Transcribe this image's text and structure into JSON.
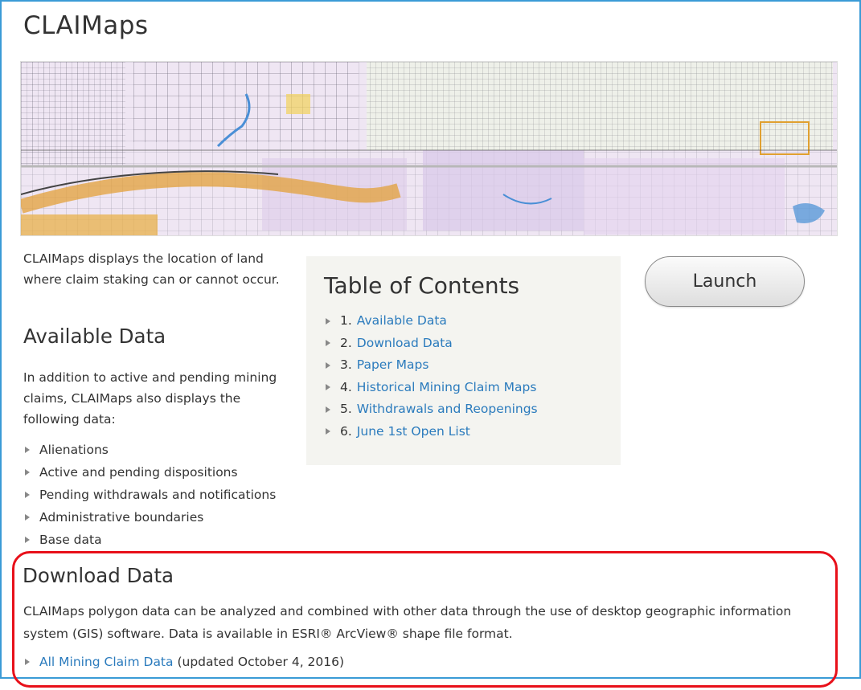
{
  "page": {
    "title": "CLAIMaps",
    "intro": "CLAIMaps displays the location of land where claim staking can or cannot occur."
  },
  "banner": {
    "alt": "CLAIMaps mining claims map"
  },
  "available": {
    "heading": "Available Data",
    "text": "In addition to active and pending mining claims, CLAIMaps also displays the following data:",
    "items": [
      "Alienations",
      "Active and pending dispositions",
      "Pending withdrawals and notifications",
      "Administrative boundaries",
      "Base data"
    ]
  },
  "toc": {
    "heading": "Table of Contents",
    "items": [
      {
        "num": "1.",
        "label": "Available Data"
      },
      {
        "num": "2.",
        "label": "Download Data"
      },
      {
        "num": "3.",
        "label": "Paper Maps"
      },
      {
        "num": "4.",
        "label": "Historical Mining Claim Maps"
      },
      {
        "num": "5.",
        "label": "Withdrawals and Reopenings"
      },
      {
        "num": "6.",
        "label": "June 1st Open List"
      }
    ]
  },
  "launch": {
    "label": "Launch"
  },
  "download": {
    "heading": "Download Data",
    "text": "CLAIMaps polygon data can be analyzed and combined with other data through the use of desktop geographic information system (GIS) software. Data is available in ESRI® ArcView® shape file format.",
    "link_label": "All Mining Claim Data",
    "link_note": " (updated October 4, 2016)"
  },
  "colors": {
    "link": "#2b7bbd",
    "frame": "#3a9bd6",
    "highlight": "#e8101a"
  }
}
